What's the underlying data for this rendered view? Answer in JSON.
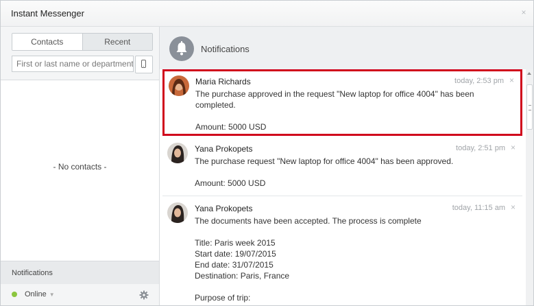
{
  "window": {
    "title": "Instant Messenger",
    "close_glyph": "×"
  },
  "left": {
    "tabs": [
      {
        "label": "Contacts",
        "active": true
      },
      {
        "label": "Recent",
        "active": false
      }
    ],
    "search": {
      "placeholder": "First or last name or department",
      "value": ""
    },
    "no_contacts": "- No contacts -",
    "notifications_label": "Notifications",
    "status": {
      "label": "Online",
      "color": "#8cc63f"
    }
  },
  "right": {
    "header_title": "Notifications",
    "close_glyph": "×",
    "items": [
      {
        "sender": "Maria Richards",
        "time": "today, 2:53 pm",
        "lines": [
          "The purchase approved in the request \"New laptop for office 4004\" has been completed.",
          "",
          "Amount: 5000 USD"
        ],
        "highlighted": true
      },
      {
        "sender": "Yana Prokopets",
        "time": "today, 2:51 pm",
        "lines": [
          "The purchase request \"New laptop for office 4004\" has been approved.",
          "",
          "Amount: 5000 USD"
        ],
        "highlighted": false
      },
      {
        "sender": "Yana Prokopets",
        "time": "today, 11:15 am",
        "lines": [
          "The documents have been accepted. The process is complete",
          "",
          "Title: Paris week 2015",
          "Start date: 19/07/2015",
          "End date: 31/07/2015",
          "Destination: Paris, France",
          "",
          "Purpose of trip:"
        ],
        "highlighted": false
      }
    ]
  },
  "colors": {
    "highlight_border": "#d0021b",
    "bell_bg": "#8a9099"
  }
}
